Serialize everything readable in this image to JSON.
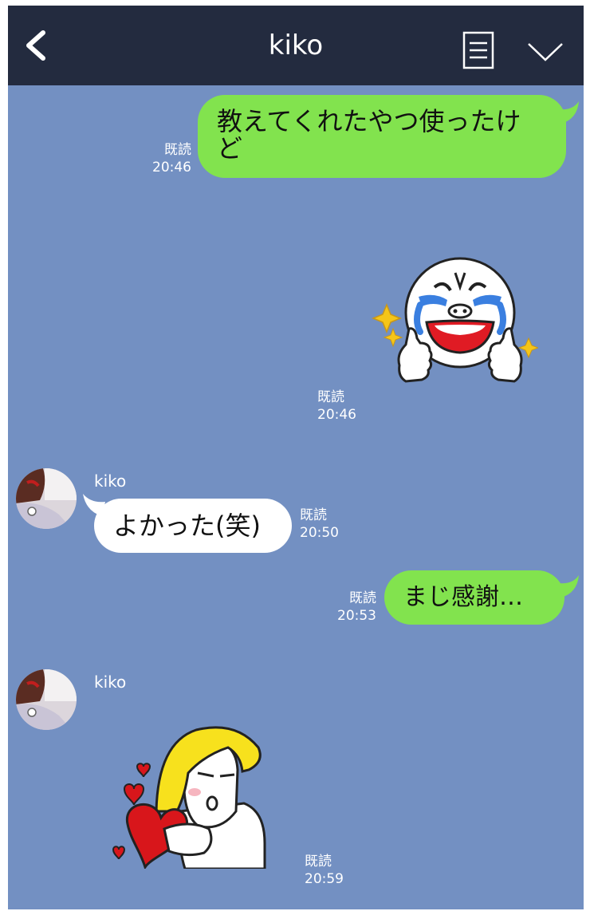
{
  "header": {
    "title": "kiko",
    "back_icon": "chevron-left-icon",
    "menu_icon": "document-list-icon",
    "more_icon": "chevron-down-icon",
    "background": "#232b3f"
  },
  "chat": {
    "background": "#7390c2",
    "outgoing_color": "#82e34e",
    "incoming_color": "#ffffff",
    "messages": [
      {
        "sender": "me",
        "type": "text",
        "lines": [
          "教えてくれたやつ使ったけ",
          "ど"
        ],
        "read": "既読",
        "time": "20:46"
      },
      {
        "sender": "me",
        "type": "sticker",
        "sticker": "moon-crying-thumbs-up",
        "read": "既読",
        "time": "20:46"
      },
      {
        "sender": "kiko",
        "name": "kiko",
        "type": "text",
        "text": "よかった(笑)",
        "read": "既読",
        "time": "20:50"
      },
      {
        "sender": "me",
        "type": "text",
        "text": "まじ感謝…",
        "read": "既読",
        "time": "20:53"
      },
      {
        "sender": "kiko",
        "name": "kiko",
        "type": "sticker",
        "sticker": "blonde-character-hearts",
        "read": "既読",
        "time": "20:59"
      }
    ]
  }
}
